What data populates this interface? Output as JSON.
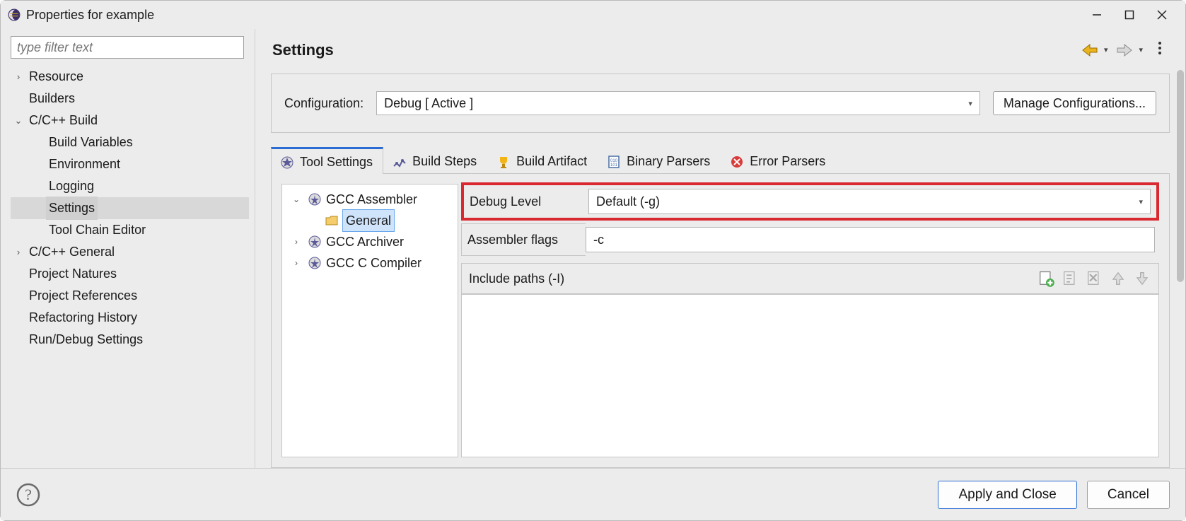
{
  "window": {
    "title": "Properties for example"
  },
  "filter": {
    "placeholder": "type filter text"
  },
  "nav": {
    "resource": "Resource",
    "builders": "Builders",
    "ccbuild": "C/C++ Build",
    "build_vars": "Build Variables",
    "environment": "Environment",
    "logging": "Logging",
    "settings": "Settings",
    "toolchain": "Tool Chain Editor",
    "ccgeneral": "C/C++ General",
    "project_natures": "Project Natures",
    "project_refs": "Project References",
    "refactoring": "Refactoring History",
    "run_debug": "Run/Debug Settings"
  },
  "header": {
    "title": "Settings"
  },
  "config": {
    "label": "Configuration:",
    "value": "Debug  [ Active ]",
    "manage": "Manage Configurations..."
  },
  "tabs": {
    "tool_settings": "Tool Settings",
    "build_steps": "Build Steps",
    "build_artifact": "Build Artifact",
    "binary_parsers": "Binary Parsers",
    "error_parsers": "Error Parsers"
  },
  "tool_tree": {
    "gcc_assembler": "GCC Assembler",
    "general": "General",
    "gcc_archiver": "GCC Archiver",
    "gcc_c_compiler": "GCC C Compiler"
  },
  "form": {
    "debug_level_label": "Debug Level",
    "debug_level_value": "Default (-g)",
    "asm_flags_label": "Assembler flags",
    "asm_flags_value": "-c",
    "include_paths_label": "Include paths (-I)"
  },
  "footer": {
    "apply": "Apply and Close",
    "cancel": "Cancel"
  }
}
